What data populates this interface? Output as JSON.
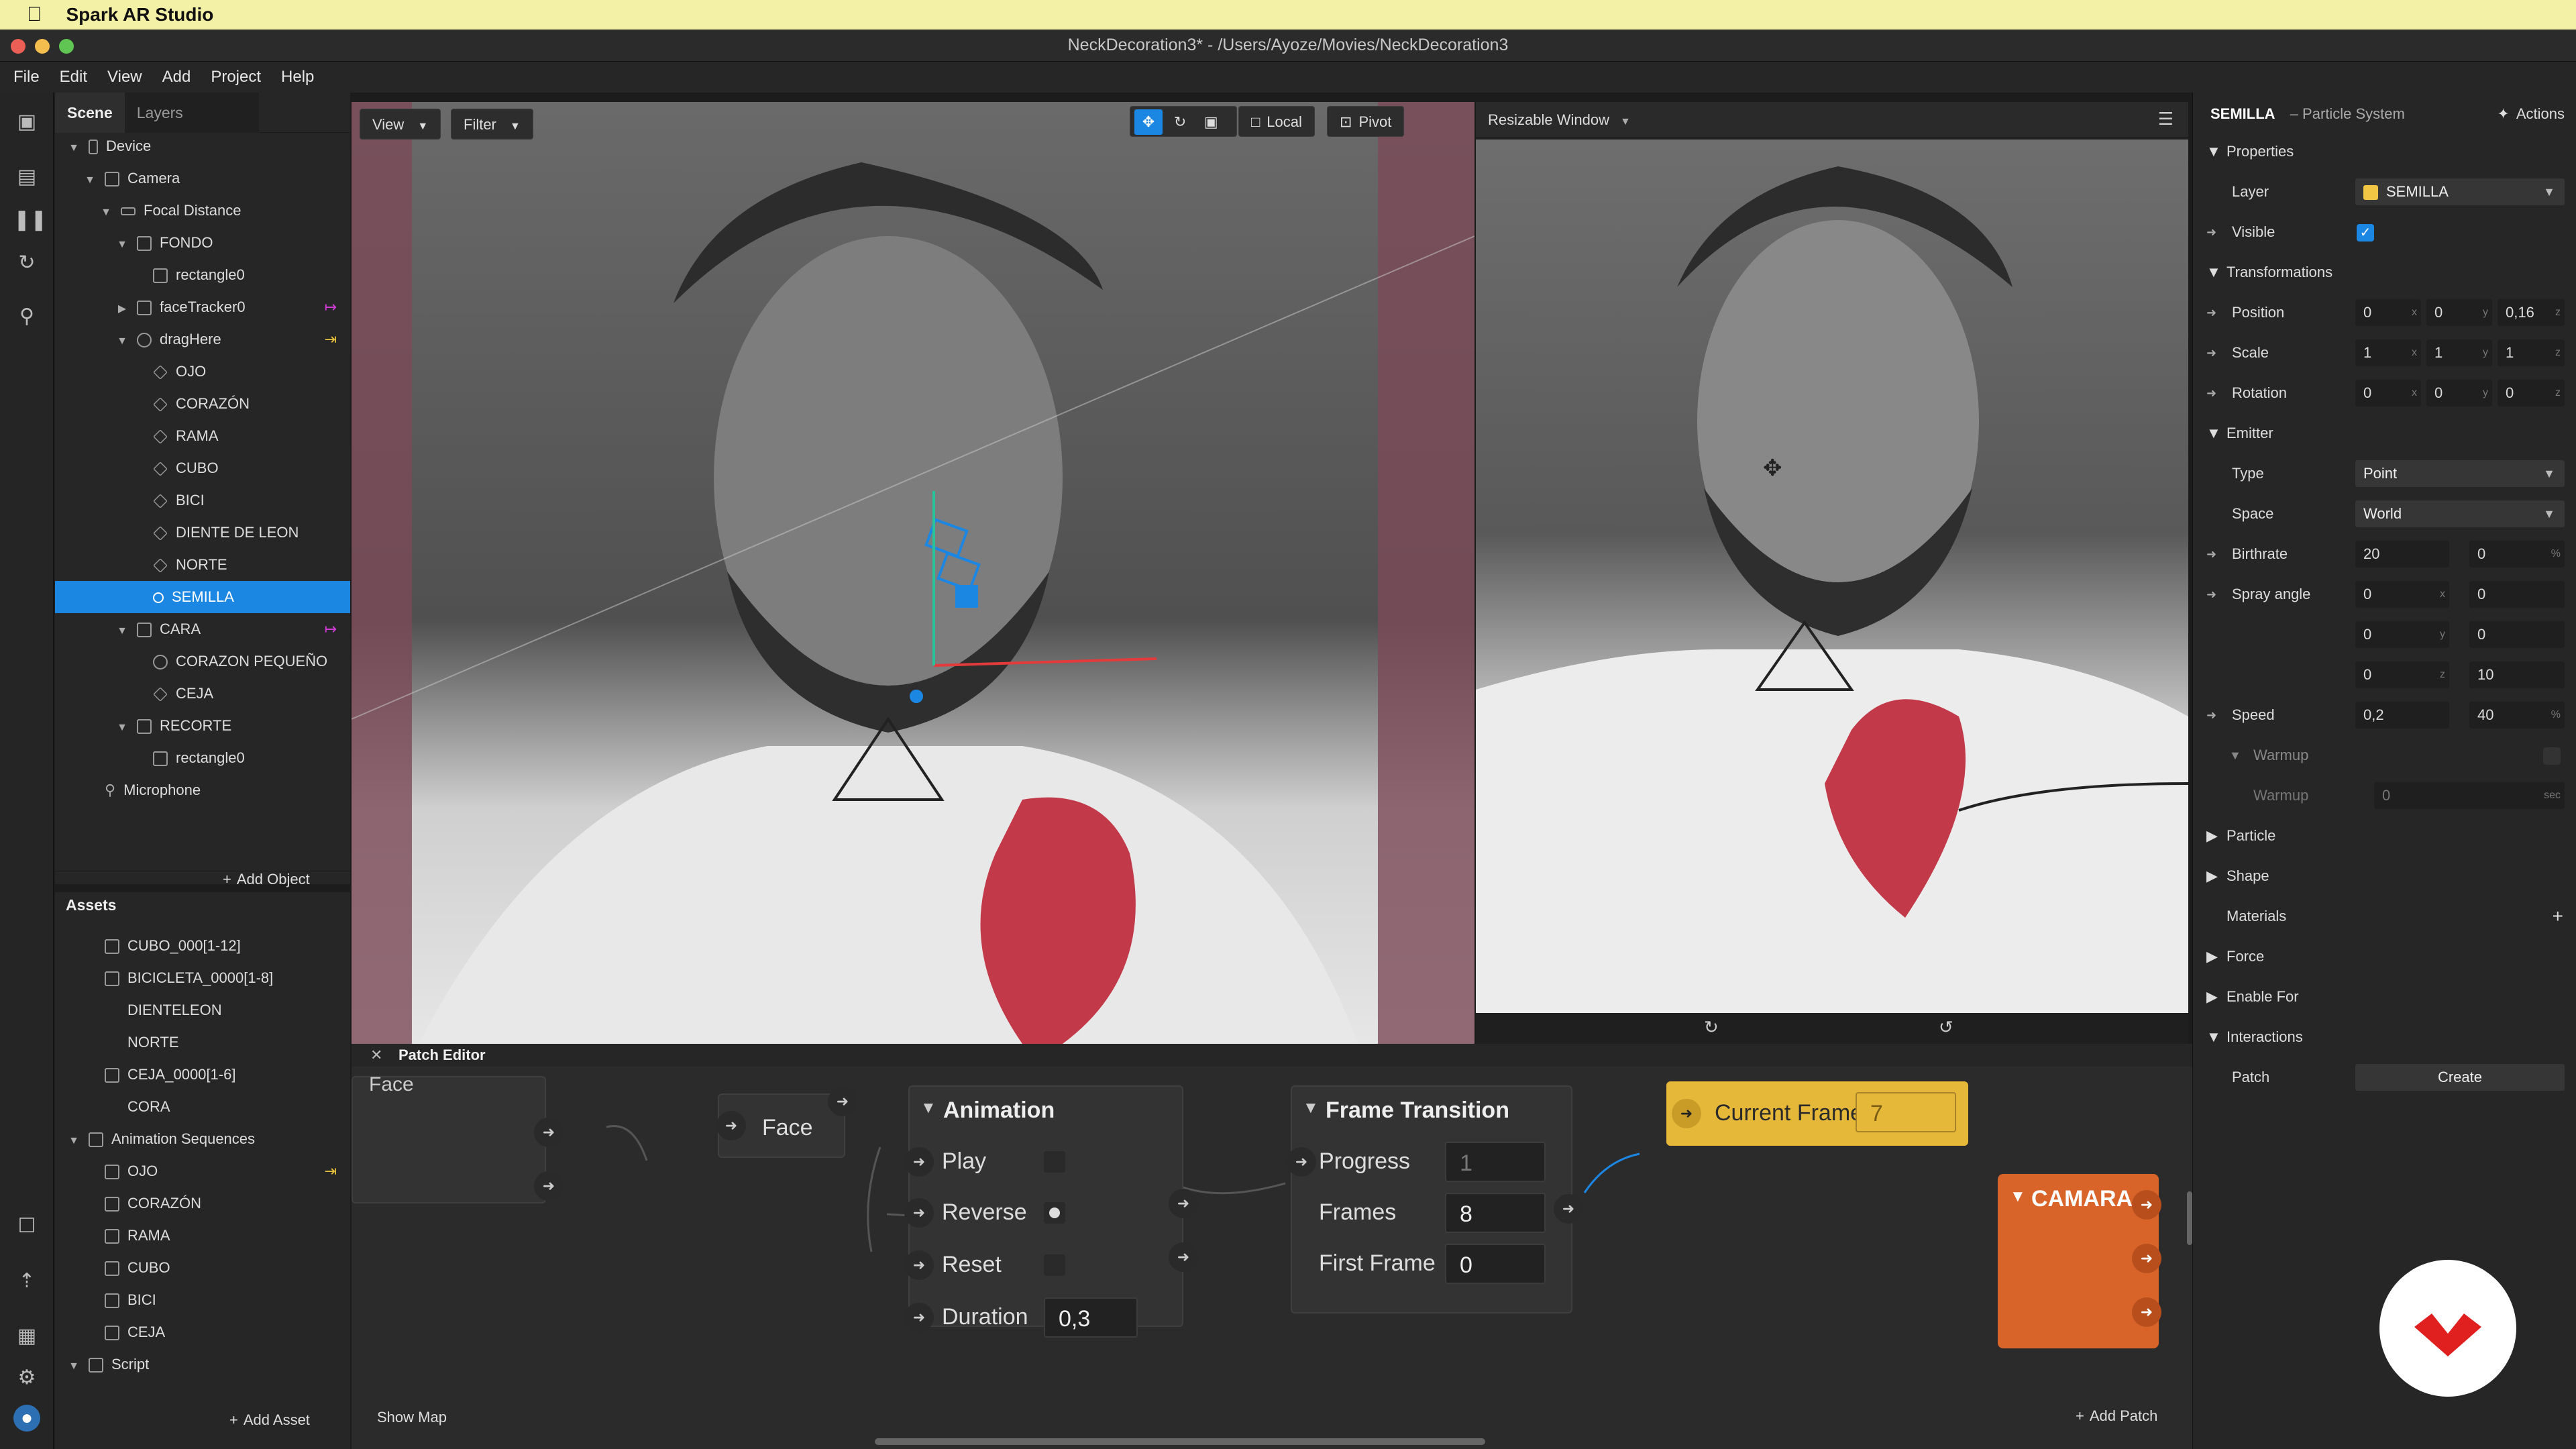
{
  "os_menubar": {
    "app_name": "Spark AR Studio"
  },
  "window": {
    "title": "NeckDecoration3* - /Users/Ayoze/Movies/NeckDecoration3"
  },
  "app_menu": [
    "File",
    "Edit",
    "View",
    "Add",
    "Project",
    "Help"
  ],
  "scene": {
    "tabs": [
      "Scene",
      "Layers"
    ],
    "tree": [
      {
        "label": "Device",
        "indent": 0
      },
      {
        "label": "Camera",
        "indent": 1
      },
      {
        "label": "Focal Distance",
        "indent": 2
      },
      {
        "label": "FONDO",
        "indent": 3
      },
      {
        "label": "rectangle0",
        "indent": 4
      },
      {
        "label": "faceTracker0",
        "indent": 3
      },
      {
        "label": "dragHere",
        "indent": 3
      },
      {
        "label": "OJO",
        "indent": 4
      },
      {
        "label": "CORAZÓN",
        "indent": 4
      },
      {
        "label": "RAMA",
        "indent": 4
      },
      {
        "label": "CUBO",
        "indent": 4
      },
      {
        "label": "BICI",
        "indent": 4
      },
      {
        "label": "DIENTE DE LEON",
        "indent": 4
      },
      {
        "label": "NORTE",
        "indent": 4
      },
      {
        "label": "SEMILLA",
        "indent": 4
      },
      {
        "label": "CARA",
        "indent": 3
      },
      {
        "label": "CORAZON PEQUEÑO",
        "indent": 4
      },
      {
        "label": "CEJA",
        "indent": 4
      },
      {
        "label": "RECORTE",
        "indent": 3
      },
      {
        "label": "rectangle0",
        "indent": 4
      },
      {
        "label": "Microphone",
        "indent": 1
      }
    ],
    "add_object": "Add Object"
  },
  "assets": {
    "title": "Assets",
    "items": [
      {
        "label": "CUBO_000[1-12]",
        "indent": 1
      },
      {
        "label": "BICICLETA_0000[1-8]",
        "indent": 1
      },
      {
        "label": "DIENTELEON",
        "indent": 1
      },
      {
        "label": "NORTE",
        "indent": 1
      },
      {
        "label": "CEJA_0000[1-6]",
        "indent": 1
      },
      {
        "label": "CORA",
        "indent": 1
      },
      {
        "label": "Animation Sequences",
        "indent": 0
      },
      {
        "label": "OJO",
        "indent": 1
      },
      {
        "label": "CORAZÓN",
        "indent": 1
      },
      {
        "label": "RAMA",
        "indent": 1
      },
      {
        "label": "CUBO",
        "indent": 1
      },
      {
        "label": "BICI",
        "indent": 1
      },
      {
        "label": "CEJA",
        "indent": 1
      },
      {
        "label": "Script",
        "indent": 0
      }
    ],
    "add_asset": "Add Asset"
  },
  "viewport": {
    "view_label": "View",
    "filter_label": "Filter",
    "local_label": "Local",
    "pivot_label": "Pivot"
  },
  "simulator": {
    "device_label": "Resizable Window"
  },
  "inspector": {
    "object_name": "SEMILLA",
    "object_type": "– Particle System",
    "actions": "Actions",
    "properties": "Properties",
    "layer_label": "Layer",
    "layer_value": "SEMILLA",
    "visible_label": "Visible",
    "visible_checked": true,
    "transformations": "Transformations",
    "position_label": "Position",
    "position": [
      "0",
      "0",
      "0,16"
    ],
    "scale_label": "Scale",
    "scale": [
      "1",
      "1",
      "1"
    ],
    "rotation_label": "Rotation",
    "rotation": [
      "0",
      "0",
      "0"
    ],
    "emitter": "Emitter",
    "type_label": "Type",
    "type_value": "Point",
    "space_label": "Space",
    "space_value": "World",
    "birthrate_label": "Birthrate",
    "birthrate": [
      "20",
      "0"
    ],
    "spray_label": "Spray angle",
    "spray": [
      "0",
      "0",
      "0",
      "0",
      "0",
      "10"
    ],
    "speed_label": "Speed",
    "speed": [
      "0,2",
      "40"
    ],
    "warmup_section": "Warmup",
    "warmup_label": "Warmup",
    "warmup_value": "0",
    "particle": "Particle",
    "shape": "Shape",
    "materials": "Materials",
    "force": "Force",
    "enable_for": "Enable For",
    "interactions": "Interactions",
    "patch_label": "Patch",
    "create_label": "Create",
    "unit_x": "x",
    "unit_y": "y",
    "unit_z": "z",
    "unit_pct": "%",
    "unit_sec": "sec"
  },
  "patch_editor": {
    "title": "Patch Editor",
    "face_label": "Face",
    "face_partial": "Face",
    "animation": {
      "title": "Animation",
      "play": "Play",
      "reverse": "Reverse",
      "reset": "Reset",
      "duration": "Duration",
      "duration_value": "0,3"
    },
    "frame_transition": {
      "title": "Frame Transition",
      "progress": "Progress",
      "progress_value": "1",
      "frames": "Frames",
      "frames_value": "8",
      "first_frame": "First Frame",
      "first_frame_value": "0"
    },
    "current_frame": {
      "label": "Current Frame",
      "value": "7"
    },
    "camara": "CAMARA",
    "show_map": "Show Map",
    "add_patch": "Add Patch"
  },
  "colors": {
    "accent": "#1c87e3",
    "patch_orange": "#d9642a",
    "current_frame_yellow": "#e6b83a",
    "menubar": "#f3f1a5"
  }
}
